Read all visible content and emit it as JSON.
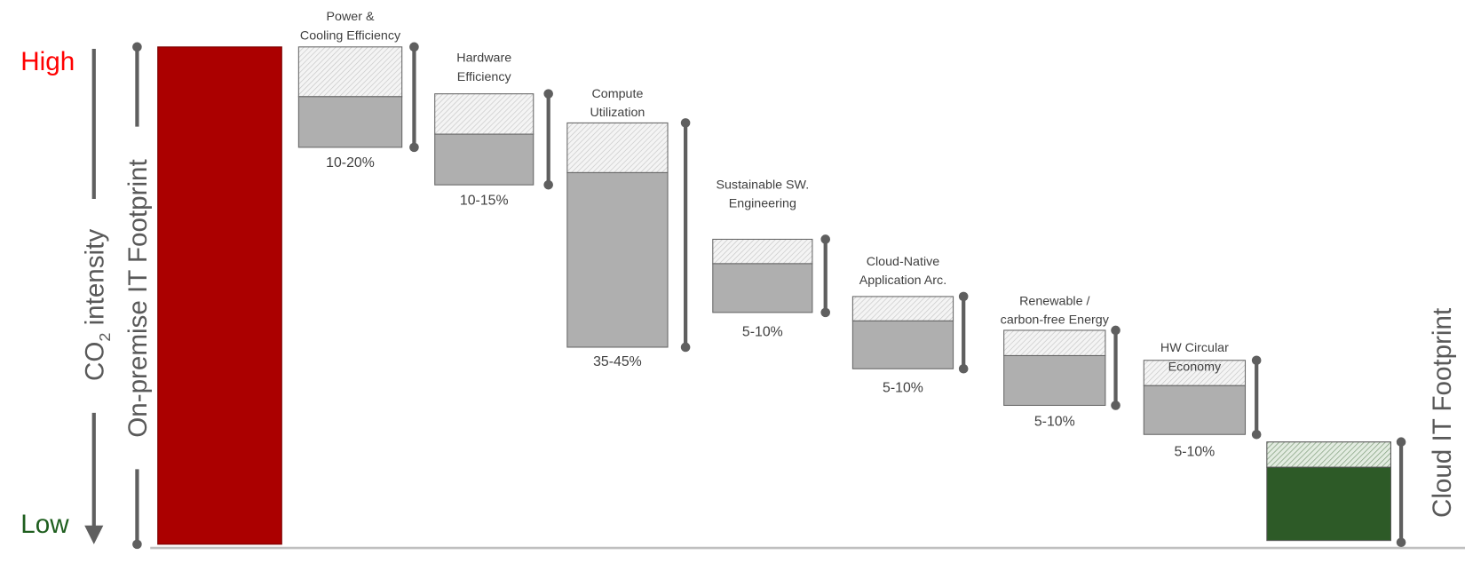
{
  "chart_data": {
    "type": "waterfall",
    "ylabel": "CO2 intensity",
    "ylabel_parts": {
      "main": "CO",
      "sub": "2",
      "rest": " intensity"
    },
    "y_high_label": "High",
    "y_low_label": "Low",
    "start": {
      "label": "On-premise IT Footprint",
      "color": "#ab0000"
    },
    "end": {
      "label": "Cloud IT Footprint",
      "color": "#2d5a27"
    },
    "steps": [
      {
        "title": [
          "Power &",
          "Cooling Efficiency"
        ],
        "range_label": "10-20%",
        "reduction_min": 10,
        "reduction_max": 20
      },
      {
        "title": [
          "Hardware",
          "Efficiency"
        ],
        "range_label": "10-15%",
        "reduction_min": 10,
        "reduction_max": 15
      },
      {
        "title": [
          "Compute",
          "Utilization"
        ],
        "range_label": "35-45%",
        "reduction_min": 35,
        "reduction_max": 45
      },
      {
        "title": [
          "Sustainable SW.",
          "Engineering"
        ],
        "range_label": "5-10%",
        "reduction_min": 5,
        "reduction_max": 10
      },
      {
        "title": [
          "Cloud-Native",
          "Application Arc."
        ],
        "range_label": "5-10%",
        "reduction_min": 5,
        "reduction_max": 10
      },
      {
        "title": [
          "Renewable /",
          "carbon-free Energy"
        ],
        "range_label": "5-10%",
        "reduction_min": 5,
        "reduction_max": 10
      },
      {
        "title": [
          "HW Circular",
          "Economy"
        ],
        "range_label": "5-10%",
        "reduction_min": 5,
        "reduction_max": 10
      }
    ],
    "colors": {
      "high": "#ff0000",
      "low": "#1e5e1e",
      "step_fill": "#afafaf",
      "bracket": "#5f5f5f",
      "baseline": "#bfbfbf"
    }
  }
}
